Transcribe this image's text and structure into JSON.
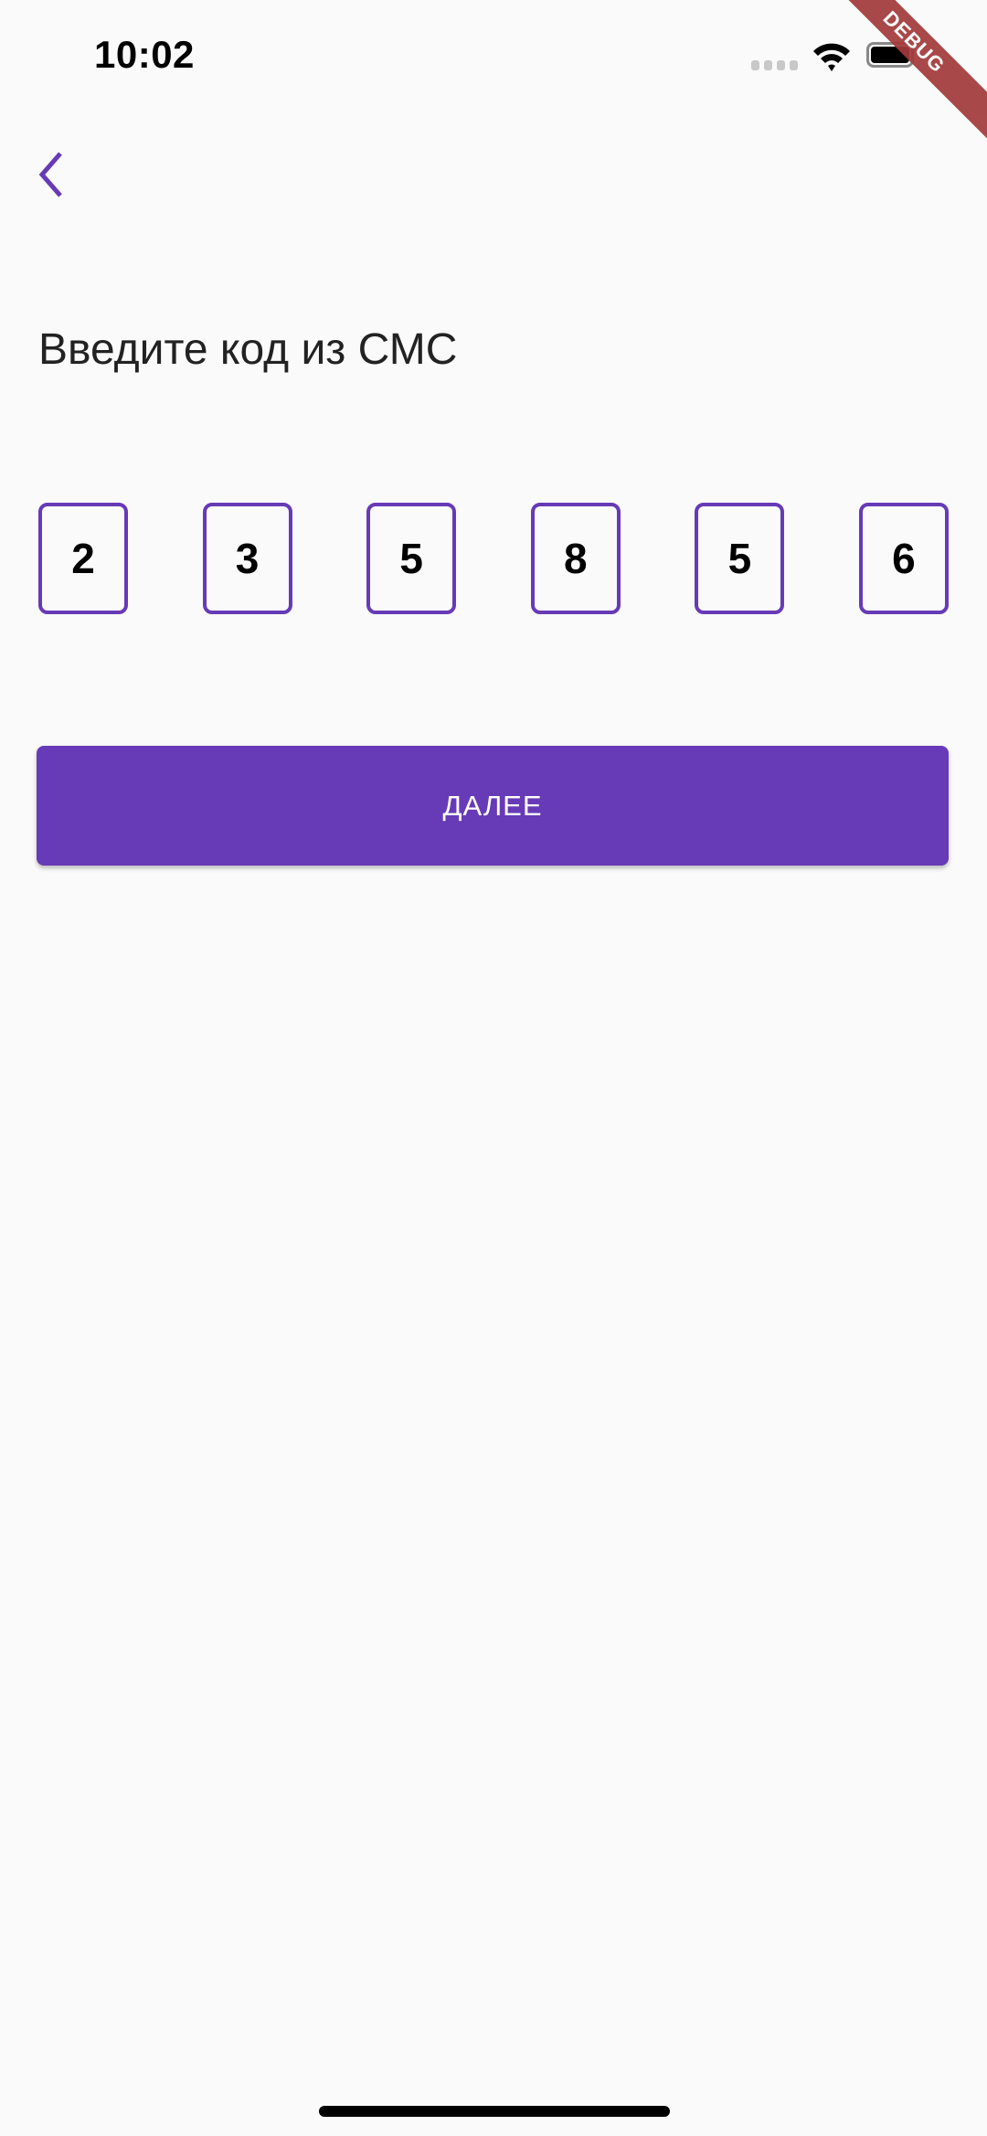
{
  "status_bar": {
    "time": "10:02"
  },
  "debug_banner": "DEBUG",
  "screen": {
    "title": "Введите код из СМС",
    "code_digits": [
      "2",
      "3",
      "5",
      "8",
      "5",
      "6"
    ],
    "next_button_label": "ДАЛЕЕ"
  },
  "colors": {
    "accent": "#673AB7",
    "background": "#FAFAFA",
    "debug": "#A3393B"
  }
}
